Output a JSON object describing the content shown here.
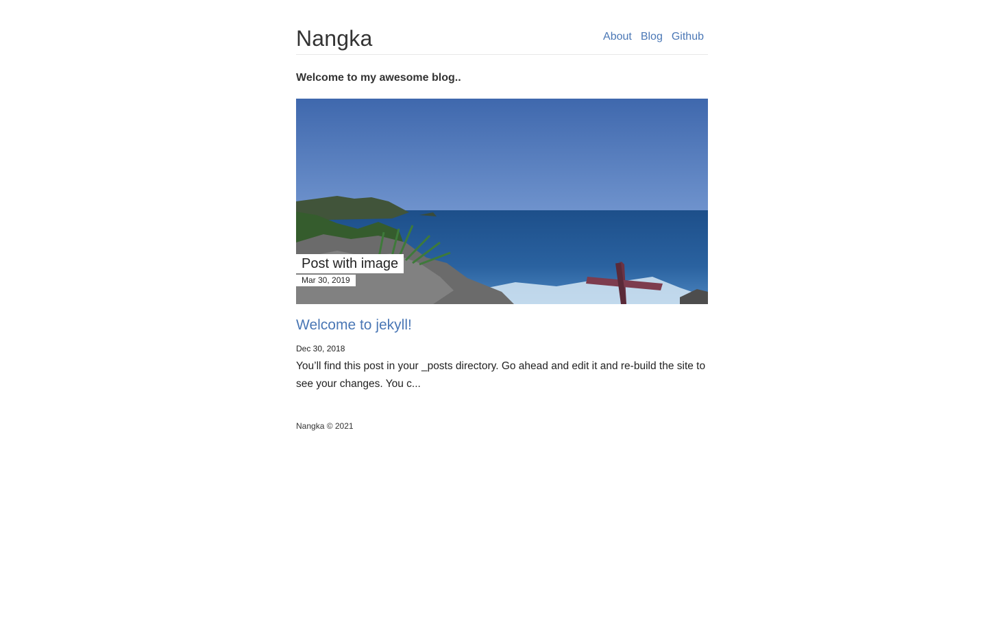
{
  "header": {
    "site_title": "Nangka",
    "nav": [
      {
        "label": "About"
      },
      {
        "label": "Blog"
      },
      {
        "label": "Github"
      }
    ]
  },
  "intro": "Welcome to my awesome blog..",
  "featured_post": {
    "title": "Post with image",
    "date": "Mar 30, 2019"
  },
  "post": {
    "title": "Welcome to jekyll!",
    "date": "Dec 30, 2018",
    "excerpt": "You’ll find this post in your _posts directory. Go ahead and edit it and re-build the site to see your changes. You c..."
  },
  "footer": "Nangka © 2021",
  "colors": {
    "link": "#4a77b5",
    "text": "#222222"
  }
}
